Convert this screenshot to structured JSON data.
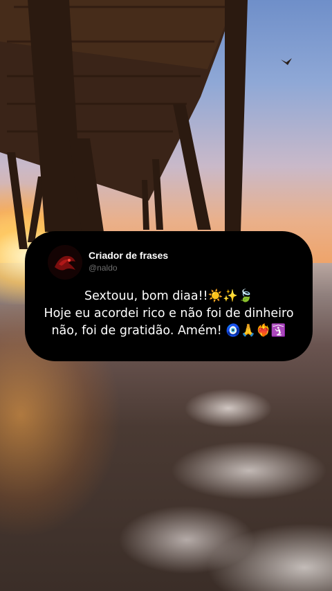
{
  "post": {
    "author_name": "Criador de frases",
    "author_handle": "@naldo",
    "lines": [
      "Sextouu, bom diaa!!☀️✨🍃",
      "Hoje eu acordei rico e não foi de dinheiro",
      "não, foi de gratidão. Amém! 🧿🙏❤️‍🔥🛐"
    ]
  },
  "colors": {
    "card_background": "#000000",
    "text_primary": "#ffffff",
    "text_secondary": "#6f6f6f"
  }
}
